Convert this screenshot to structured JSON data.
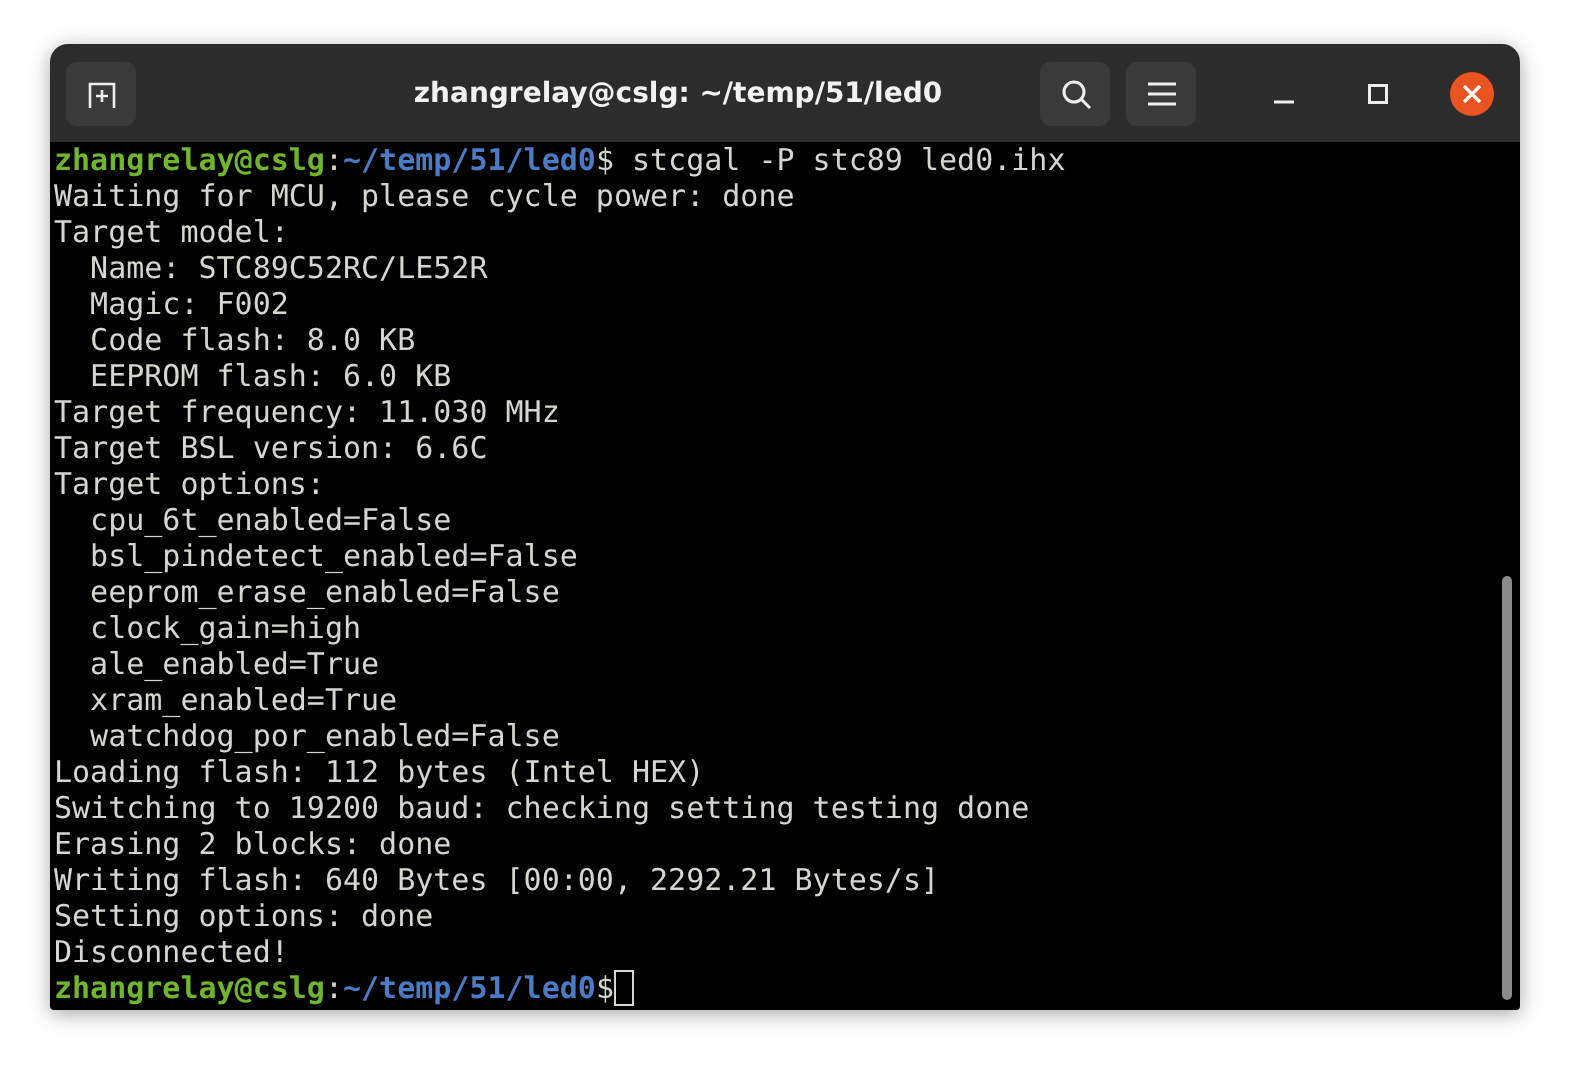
{
  "window": {
    "title": "zhangrelay@cslg: ~/temp/51/led0"
  },
  "terminal": {
    "lines": [
      {
        "kind": "prompt",
        "user_host": "zhangrelay@cslg",
        "separator": ":",
        "path": "~/temp/51/led0",
        "sign": "$",
        "command": " stcgal -P stc89 led0.ihx",
        "cursor": false
      },
      {
        "kind": "output",
        "text": "Waiting for MCU, please cycle power: done"
      },
      {
        "kind": "output",
        "text": "Target model:"
      },
      {
        "kind": "output",
        "text": "  Name: STC89C52RC/LE52R"
      },
      {
        "kind": "output",
        "text": "  Magic: F002"
      },
      {
        "kind": "output",
        "text": "  Code flash: 8.0 KB"
      },
      {
        "kind": "output",
        "text": "  EEPROM flash: 6.0 KB"
      },
      {
        "kind": "output",
        "text": "Target frequency: 11.030 MHz"
      },
      {
        "kind": "output",
        "text": "Target BSL version: 6.6C"
      },
      {
        "kind": "output",
        "text": "Target options:"
      },
      {
        "kind": "output",
        "text": "  cpu_6t_enabled=False"
      },
      {
        "kind": "output",
        "text": "  bsl_pindetect_enabled=False"
      },
      {
        "kind": "output",
        "text": "  eeprom_erase_enabled=False"
      },
      {
        "kind": "output",
        "text": "  clock_gain=high"
      },
      {
        "kind": "output",
        "text": "  ale_enabled=True"
      },
      {
        "kind": "output",
        "text": "  xram_enabled=True"
      },
      {
        "kind": "output",
        "text": "  watchdog_por_enabled=False"
      },
      {
        "kind": "output",
        "text": "Loading flash: 112 bytes (Intel HEX)"
      },
      {
        "kind": "output",
        "text": "Switching to 19200 baud: checking setting testing done"
      },
      {
        "kind": "output",
        "text": "Erasing 2 blocks: done"
      },
      {
        "kind": "output",
        "text": "Writing flash: 640 Bytes [00:00, 2292.21 Bytes/s]"
      },
      {
        "kind": "output",
        "text": "Setting options: done"
      },
      {
        "kind": "output",
        "text": "Disconnected!"
      },
      {
        "kind": "prompt",
        "user_host": "zhangrelay@cslg",
        "separator": ":",
        "path": "~/temp/51/led0",
        "sign": "$",
        "cursor": true
      }
    ]
  }
}
